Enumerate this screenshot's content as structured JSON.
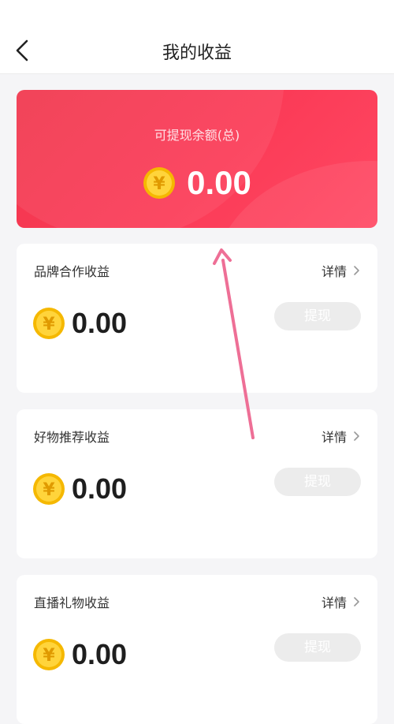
{
  "header": {
    "title": "我的收益"
  },
  "total": {
    "label": "可提现余额(总)",
    "amount": "0.00"
  },
  "cards": [
    {
      "title": "品牌合作收益",
      "detail_label": "详情",
      "amount": "0.00",
      "withdraw_label": "提现"
    },
    {
      "title": "好物推荐收益",
      "detail_label": "详情",
      "amount": "0.00",
      "withdraw_label": "提现"
    },
    {
      "title": "直播礼物收益",
      "detail_label": "详情",
      "amount": "0.00",
      "withdraw_label": "提现"
    }
  ],
  "colors": {
    "accent_red": "#fb3b57",
    "coin_gold": "#f5b800",
    "annotation_arrow": "#ee6f96",
    "disabled_button": "#ececec"
  },
  "icons": {
    "back": "chevron-left-icon",
    "detail": "chevron-right-icon",
    "coin": "yuan-coin-icon"
  }
}
